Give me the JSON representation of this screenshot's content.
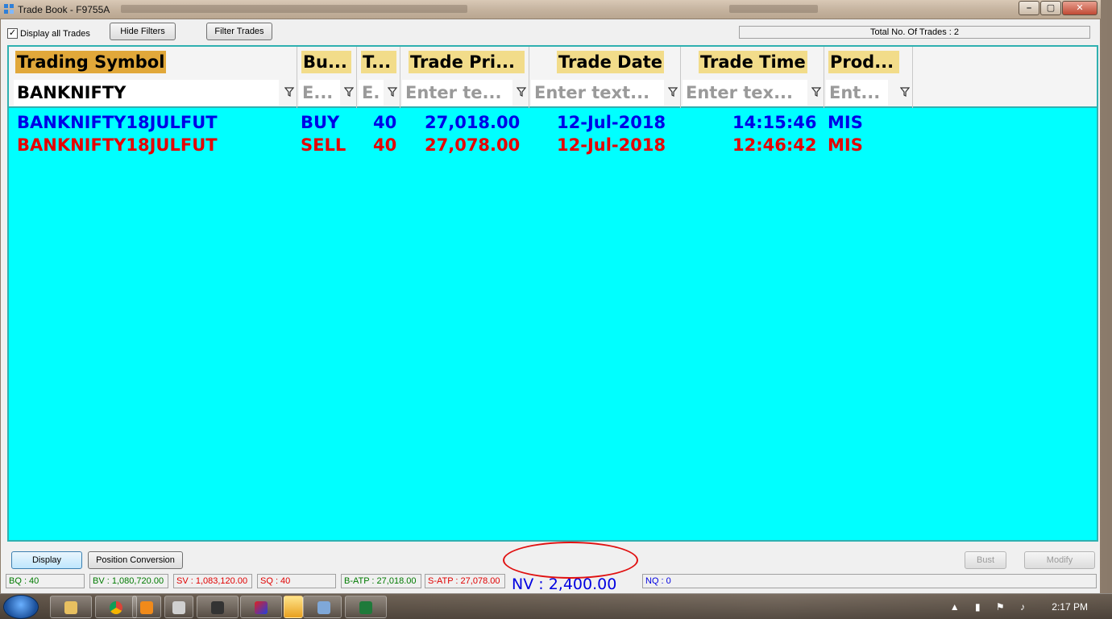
{
  "window": {
    "title": "Trade Book - F9755A"
  },
  "toolbar": {
    "display_all_label": "Display all Trades",
    "display_all_checked": "✓",
    "hide_filters_label": "Hide Filters",
    "filter_trades_label": "Filter Trades",
    "total_trades": "Total No. Of Trades : 2"
  },
  "grid": {
    "columns": [
      {
        "header": "Trading Symbol",
        "filter": "BANKNIFTY"
      },
      {
        "header": "Bu...",
        "filter": "E..."
      },
      {
        "header": "T...",
        "filter": "E."
      },
      {
        "header": "Trade Pri...",
        "filter": "Enter te..."
      },
      {
        "header": "Trade Date",
        "filter": "Enter text..."
      },
      {
        "header": "Trade Time",
        "filter": "Enter tex..."
      },
      {
        "header": "Prod...",
        "filter": "Ent..."
      }
    ],
    "rows": [
      {
        "symbol": "BANKNIFTY18JULFUT",
        "side": "BUY",
        "qty": "40",
        "price": "27,018.00",
        "date": "12-Jul-2018",
        "time": "14:15:46",
        "product": "MIS"
      },
      {
        "symbol": "BANKNIFTY18JULFUT",
        "side": "SELL",
        "qty": "40",
        "price": "27,078.00",
        "date": "12-Jul-2018",
        "time": "12:46:42",
        "product": "MIS"
      }
    ]
  },
  "actions": {
    "display": "Display",
    "position_conversion": "Position Conversion",
    "bust": "Bust",
    "modify": "Modify"
  },
  "status": {
    "bq": "BQ : 40",
    "bv": "BV : 1,080,720.00",
    "sv": "SV : 1,083,120.00",
    "sq": "SQ : 40",
    "batp": "B-ATP : 27,018.00",
    "satp": "S-ATP : 27,078.00",
    "nv": "NV : 2,400.00",
    "nq": "NQ : 0"
  },
  "taskbar": {
    "clock": "2:17 PM"
  },
  "colors": {
    "grid_bg": "#00ffff",
    "buy": "#0000e6",
    "sell": "#e60000",
    "header_highlight": "#e1a83a",
    "header_soft": "#f2dc8a",
    "annotation": "#e01010"
  }
}
